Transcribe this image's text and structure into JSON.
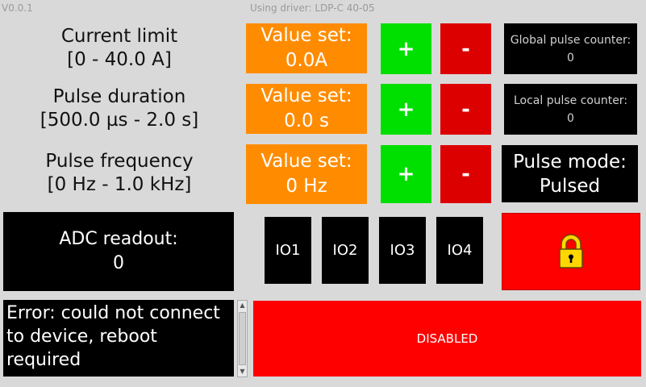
{
  "header": {
    "version": "V0.0.1",
    "driver_text": "Using driver: LDP-C 40-05"
  },
  "params": [
    {
      "label": "Current limit",
      "range": "[0 - 40.0 A]",
      "value_title": "Value set:",
      "value": "0.0A",
      "plus": "+",
      "minus": "-"
    },
    {
      "label": "Pulse duration",
      "range": "[500.0 µs - 2.0 s]",
      "value_title": "Value set:",
      "value": "0.0 s",
      "plus": "+",
      "minus": "-"
    },
    {
      "label": "Pulse frequency",
      "range": "[0 Hz - 1.0 kHz]",
      "value_title": "Value set:",
      "value": "0 Hz",
      "plus": "+",
      "minus": "-"
    }
  ],
  "counters": {
    "global_label": "Global pulse counter:",
    "global_value": "0",
    "local_label": "Local pulse counter:",
    "local_value": "0"
  },
  "mode": {
    "label": "Pulse mode:",
    "value": "Pulsed"
  },
  "adc": {
    "label": "ADC readout:",
    "value": "0"
  },
  "io_buttons": [
    "IO1",
    "IO2",
    "IO3",
    "IO4"
  ],
  "lock": {
    "icon": "lock-icon",
    "colors": {
      "body": "#ffd600",
      "shackle": "#ffd600",
      "keyhole": "#000000"
    }
  },
  "error": {
    "message": "Error: could not connect to device, reboot required"
  },
  "state_button": {
    "label": "DISABLED"
  },
  "colors": {
    "background": "#d9d9d9",
    "orange": "#ff8c00",
    "green": "#00e000",
    "red": "#dd0000",
    "black": "#000000"
  }
}
